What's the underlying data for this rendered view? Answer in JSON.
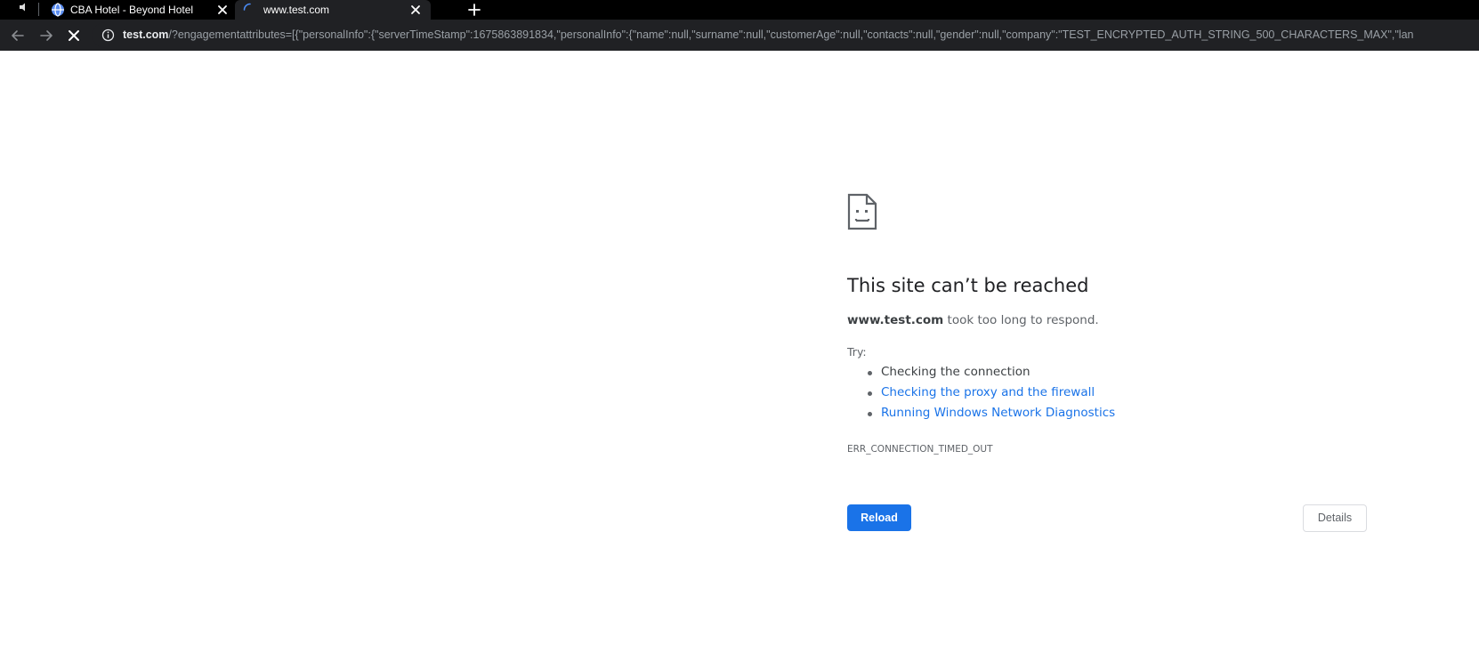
{
  "browser": {
    "tabs": [
      {
        "title": "CBA Hotel - Beyond Hotel",
        "favicon": "globe-icon",
        "active": false
      },
      {
        "title": "www.test.com",
        "favicon": "loading-spinner-icon",
        "active": true
      }
    ],
    "audio_icon": "speaker-icon",
    "new_tab_icon": "plus-icon",
    "address_bar": {
      "security_icon": "info-icon",
      "host": "test.com",
      "path": "/?engagementattributes=[{\"personalInfo\":{\"serverTimeStamp\":1675863891834,\"personalInfo\":{\"name\":null,\"surname\":null,\"customerAge\":null,\"contacts\":null,\"gender\":null,\"company\":\"TEST_ENCRYPTED_AUTH_STRING_500_CHARACTERS_MAX\",\"lan"
    },
    "nav_icons": [
      "back-arrow-icon",
      "forward-arrow-icon",
      "stop-loading-icon"
    ]
  },
  "error_page": {
    "icon": "sad-page-icon",
    "title": "This site can’t be reached",
    "summary_host": "www.test.com",
    "summary_rest": " took too long to respond.",
    "try_label": "Try:",
    "suggestions": [
      {
        "text": "Checking the connection",
        "link": false
      },
      {
        "text": "Checking the proxy and the firewall",
        "link": true
      },
      {
        "text": "Running Windows Network Diagnostics",
        "link": true
      }
    ],
    "error_code": "ERR_CONNECTION_TIMED_OUT",
    "reload_label": "Reload",
    "details_label": "Details"
  },
  "colors": {
    "tabstrip": "#000000",
    "toolbar": "#202124",
    "link": "#1a73e8",
    "primary_button": "#1a73e8"
  }
}
